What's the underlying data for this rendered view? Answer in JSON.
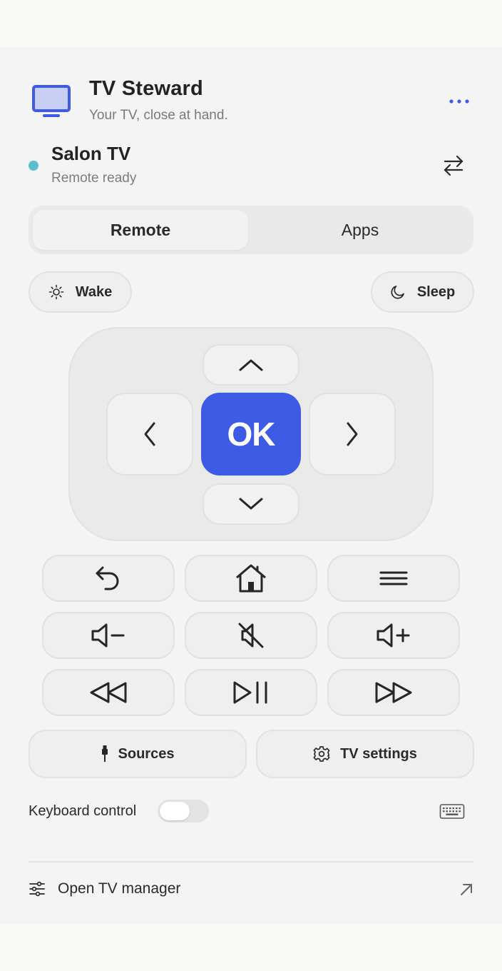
{
  "app": {
    "title": "TV Steward",
    "subtitle": "Your TV, close at hand.",
    "icon": "tv-icon",
    "menu_icon": "more-dots-icon"
  },
  "device": {
    "name": "Salon TV",
    "status": "Remote ready",
    "status_color": "#5bbfcf",
    "switch_icon": "swap-arrows-icon"
  },
  "tabs": [
    {
      "label": "Remote",
      "active": true
    },
    {
      "label": "Apps",
      "active": false
    }
  ],
  "power": {
    "wake_label": "Wake",
    "wake_icon": "sun-icon",
    "sleep_label": "Sleep",
    "sleep_icon": "moon-icon"
  },
  "dpad": {
    "ok_label": "OK",
    "up_icon": "chevron-up-icon",
    "down_icon": "chevron-down-icon",
    "left_icon": "chevron-left-icon",
    "right_icon": "chevron-right-icon"
  },
  "controls": [
    {
      "name": "back",
      "icon": "back-arrow-icon"
    },
    {
      "name": "home",
      "icon": "home-icon"
    },
    {
      "name": "menu",
      "icon": "hamburger-menu-icon"
    },
    {
      "name": "volume-down",
      "icon": "volume-down-icon"
    },
    {
      "name": "mute",
      "icon": "mute-icon"
    },
    {
      "name": "volume-up",
      "icon": "volume-up-icon"
    },
    {
      "name": "rewind",
      "icon": "rewind-icon"
    },
    {
      "name": "play-pause",
      "icon": "play-pause-icon"
    },
    {
      "name": "fast-forward",
      "icon": "fast-forward-icon"
    }
  ],
  "actions": {
    "sources_label": "Sources",
    "sources_icon": "plug-icon",
    "settings_label": "TV settings",
    "settings_icon": "gear-icon"
  },
  "keyboard": {
    "label": "Keyboard control",
    "enabled": false,
    "icon": "keyboard-icon"
  },
  "footer": {
    "label": "Open TV manager",
    "icon": "sliders-icon",
    "link_icon": "external-arrow-icon"
  },
  "colors": {
    "accent": "#3d5be4",
    "tv_screen": "#c9cff2",
    "background": "#f4f4f4"
  }
}
